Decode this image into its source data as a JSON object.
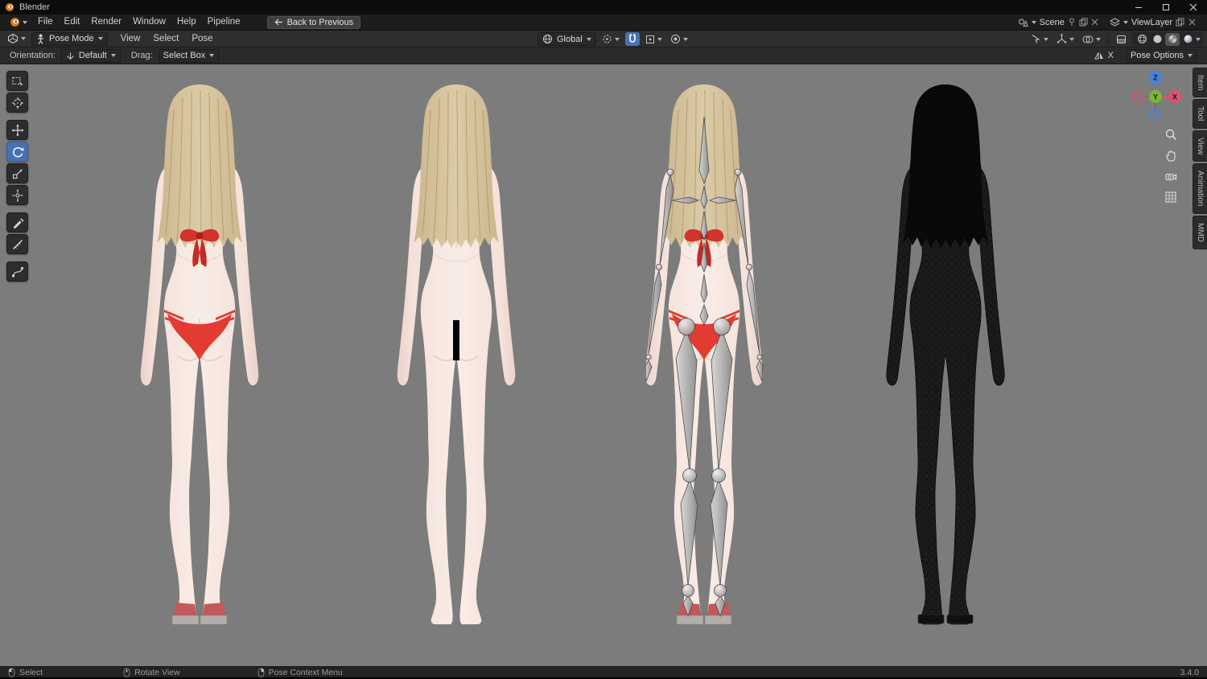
{
  "window": {
    "title": "Blender"
  },
  "topbar": {
    "menus": [
      "File",
      "Edit",
      "Render",
      "Window",
      "Help",
      "Pipeline"
    ],
    "back_button": "Back to Previous",
    "scene": {
      "label": "Scene"
    },
    "viewlayer": {
      "label": "ViewLayer"
    }
  },
  "header": {
    "mode_select": "Pose Mode",
    "menus": [
      "View",
      "Select",
      "Pose"
    ],
    "orientation": "Global"
  },
  "tool_settings": {
    "orientation_label": "Orientation:",
    "orientation_value": "Default",
    "drag_label": "Drag:",
    "drag_value": "Select Box",
    "mirror_x": "X",
    "pose_options": "Pose Options"
  },
  "toolbar_tools": [
    "select-box",
    "cursor",
    "move",
    "rotate",
    "scale",
    "transform",
    "annotate",
    "measure",
    "pose-specials"
  ],
  "active_tool": "rotate",
  "nav_icons": [
    "zoom",
    "pan",
    "camera-view",
    "toggle-grid"
  ],
  "sidebar_tabs": [
    "Item",
    "Tool",
    "View",
    "Animation",
    "MMD"
  ],
  "gizmo": {
    "x": "X",
    "y": "Y",
    "z": "Z"
  },
  "statusbar": {
    "items": [
      {
        "icon": "mouse-left-icon",
        "label": "Select"
      },
      {
        "icon": "mouse-middle-icon",
        "label": "Rotate View"
      },
      {
        "icon": "mouse-right-icon",
        "label": "Pose Context Menu"
      }
    ],
    "version": "3.4.0"
  },
  "viewport": {
    "figures": [
      "model-bikini",
      "model-censored",
      "model-armature",
      "model-wireframe"
    ],
    "colors": {
      "background": "#7c7c7c",
      "skin": "#f3ded7",
      "hair": "#cdb88f",
      "bikini": "#e23b31",
      "censor": "#000000",
      "accent": "#4772b3"
    }
  }
}
